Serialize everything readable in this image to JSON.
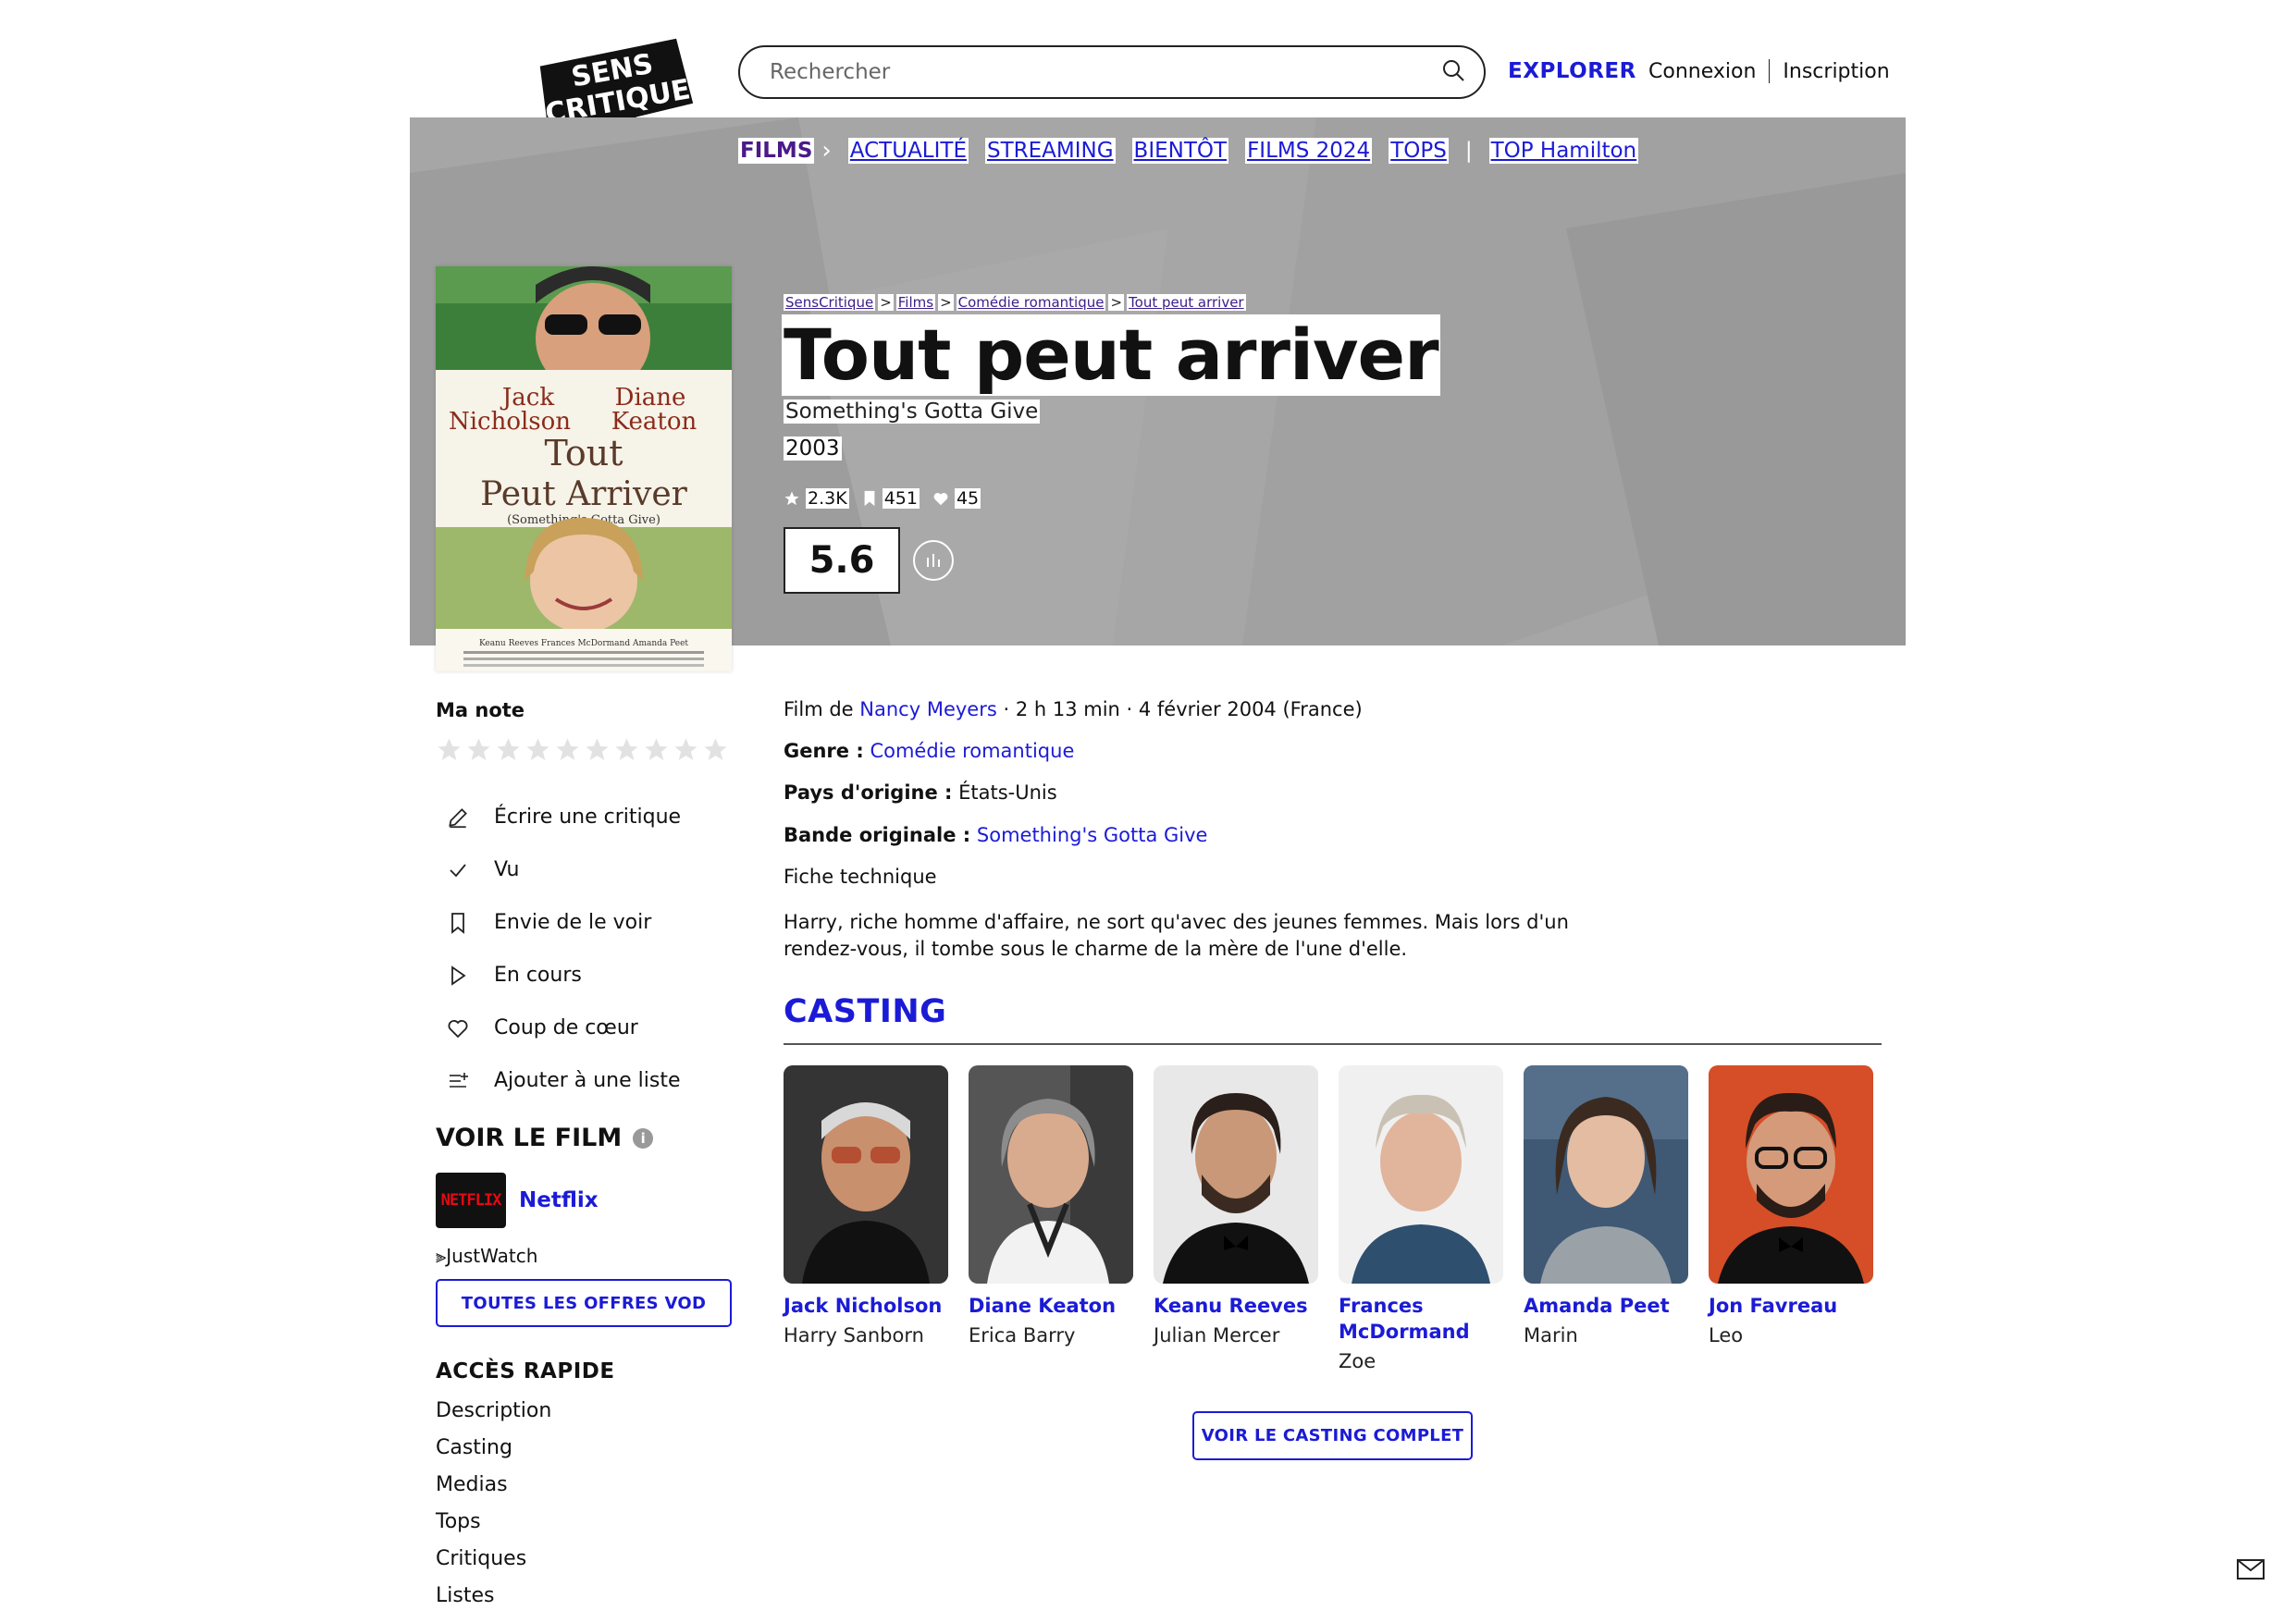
{
  "header": {
    "logo_line1": "SENS",
    "logo_line2": "CRITIQUE",
    "search_placeholder": "Rechercher",
    "explore_label": "EXPLORER",
    "login_label": "Connexion",
    "signup_label": "Inscription"
  },
  "nav": {
    "section": "FILMS",
    "items": [
      "ACTUALITÉ",
      "STREAMING",
      "BIENTÔT",
      "FILMS 2024",
      "TOPS"
    ],
    "top_link": "TOP Hamilton"
  },
  "breadcrumb": [
    "SensCritique",
    "Films",
    "Comédie romantique",
    "Tout peut arriver"
  ],
  "film": {
    "title": "Tout peut arriver",
    "original_title": "Something's Gotta Give",
    "year": "2003",
    "stats": {
      "ratings": "2.3K",
      "wishlist": "451",
      "favorites": "45"
    },
    "score": "5.6",
    "director_prefix": "Film de",
    "director": "Nancy Meyers",
    "meta_suffix": "· 2 h 13 min · 4 février 2004 (France)",
    "genre_label": "Genre :",
    "genre": "Comédie romantique",
    "country_label": "Pays d'origine :",
    "country": "États-Unis",
    "soundtrack_label": "Bande originale :",
    "soundtrack": "Something's Gotta Give",
    "tech_sheet": "Fiche technique",
    "synopsis": "Harry, riche homme d'affaire, ne sort qu'avec des jeunes femmes. Mais lors d'un rendez-vous, il tombe sous le charme de la mère de l'une d'elle."
  },
  "poster": {
    "name_left_1": "Jack",
    "name_left_2": "Nicholson",
    "name_right_1": "Diane",
    "name_right_2": "Keaton",
    "title_1": "Tout",
    "title_2": "Peut Arriver",
    "subtitle": "(Something's Gotta Give)",
    "credits": "Keanu Reeves   Frances McDormand   Amanda Peet"
  },
  "sidebar": {
    "my_rating_label": "Ma note",
    "actions": [
      {
        "label": "Écrire une critique",
        "icon": "pencil-icon"
      },
      {
        "label": "Vu",
        "icon": "check-icon"
      },
      {
        "label": "Envie de le voir",
        "icon": "bookmark-icon"
      },
      {
        "label": "En cours",
        "icon": "play-icon"
      },
      {
        "label": "Coup de cœur",
        "icon": "heart-icon"
      },
      {
        "label": "Ajouter à une liste",
        "icon": "list-add-icon"
      }
    ],
    "watch_title": "VOIR LE FILM",
    "provider_logo_text": "NETFLIX",
    "provider_name": "Netflix",
    "justwatch": "JustWatch",
    "vod_button": "TOUTES LES OFFRES VOD",
    "quick_access_title": "ACCÈS RAPIDE",
    "quick_links": [
      "Description",
      "Casting",
      "Medias",
      "Tops",
      "Critiques",
      "Listes"
    ]
  },
  "casting": {
    "title": "CASTING",
    "actors": [
      {
        "name": "Jack Nicholson",
        "role": "Harry Sanborn"
      },
      {
        "name": "Diane Keaton",
        "role": "Erica Barry"
      },
      {
        "name": "Keanu Reeves",
        "role": "Julian Mercer"
      },
      {
        "name": "Frances McDormand",
        "role": "Zoe"
      },
      {
        "name": "Amanda Peet",
        "role": "Marin"
      },
      {
        "name": "Jon Favreau",
        "role": "Leo"
      }
    ],
    "full_button": "VOIR LE CASTING COMPLET"
  },
  "colors": {
    "accent": "#1b1bd6",
    "banner": "#a6a6a6",
    "netflix_red": "#e50914"
  }
}
